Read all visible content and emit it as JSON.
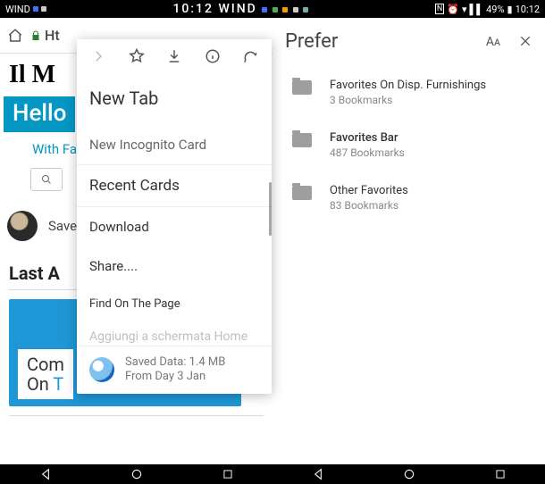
{
  "status": {
    "carrier": "WIND",
    "clock_left": "10:12",
    "wind_text": "WIND",
    "battery": "49%",
    "clock_right": "10:12"
  },
  "browser": {
    "url_text": "Ht"
  },
  "page": {
    "masthead": "Il M",
    "hello": "Hello",
    "with_favorites": "With Favorites",
    "save_history": "Save History",
    "last_a": "Last A",
    "card_line1": "Com",
    "card_line2a": "On",
    "card_line2b": " T"
  },
  "menu": {
    "new_tab": "New Tab",
    "new_incognito": "New Incognito Card",
    "recent_cards": "Recent Cards",
    "download": "Download",
    "share": "Share....",
    "find_on_page": "Find On The Page",
    "add_home_faded": "Aggiungi a schermata Home",
    "saved_line1": "Saved Data: 1.4 MB",
    "saved_line2": "From Day 3 Jan"
  },
  "prefer": {
    "title": "Prefer",
    "aa": "Aᴀ",
    "items": [
      {
        "title": "Favorites On Disp. Furnishings",
        "sub": "3 Bookmarks"
      },
      {
        "title": "Favorites Bar",
        "sub": "487 Bookmarks"
      },
      {
        "title": "Other Favorites",
        "sub": "83 Bookmarks"
      }
    ]
  }
}
